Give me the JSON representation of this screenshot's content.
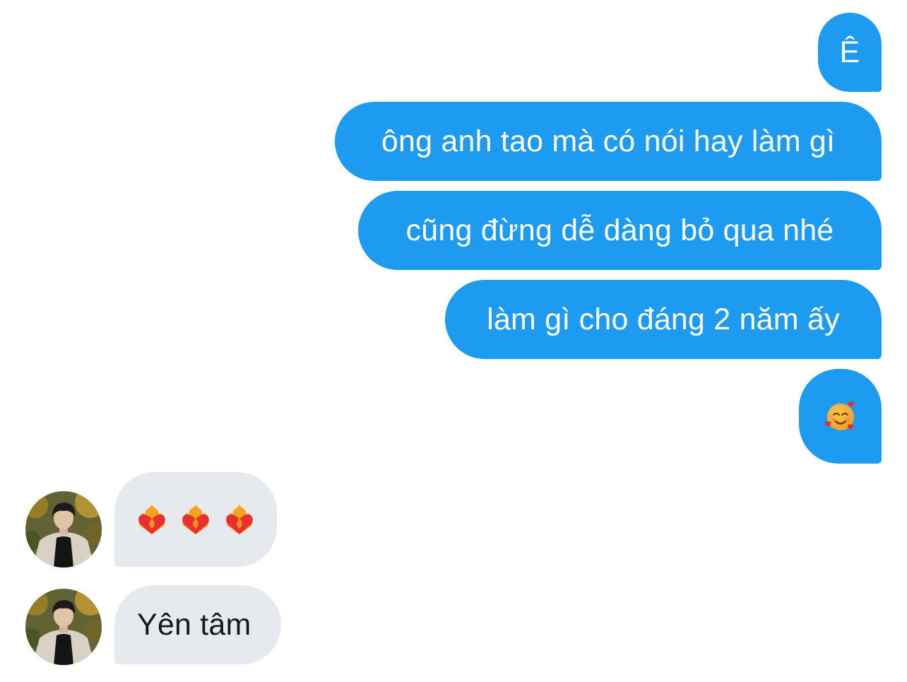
{
  "conversation": {
    "sent_messages": [
      {
        "text": "Ê"
      },
      {
        "text": "ông anh tao mà có nói hay làm gì"
      },
      {
        "text": "cũng đừng dễ dàng bỏ qua nhé"
      },
      {
        "text": "làm gì cho đáng 2 năm ấy"
      },
      {
        "text": "🥰",
        "emoji": "smiling-face-with-hearts-icon"
      }
    ],
    "received_messages": [
      {
        "text": "❤️‍🔥❤️‍🔥❤️‍🔥",
        "emoji": "heart-on-fire-icon"
      },
      {
        "text": "Yên tâm"
      }
    ]
  },
  "colors": {
    "sent_bubble": "#1d9bf0",
    "received_bubble": "#e6eaef",
    "sent_text": "#ffffff",
    "received_text": "#141a1f"
  }
}
